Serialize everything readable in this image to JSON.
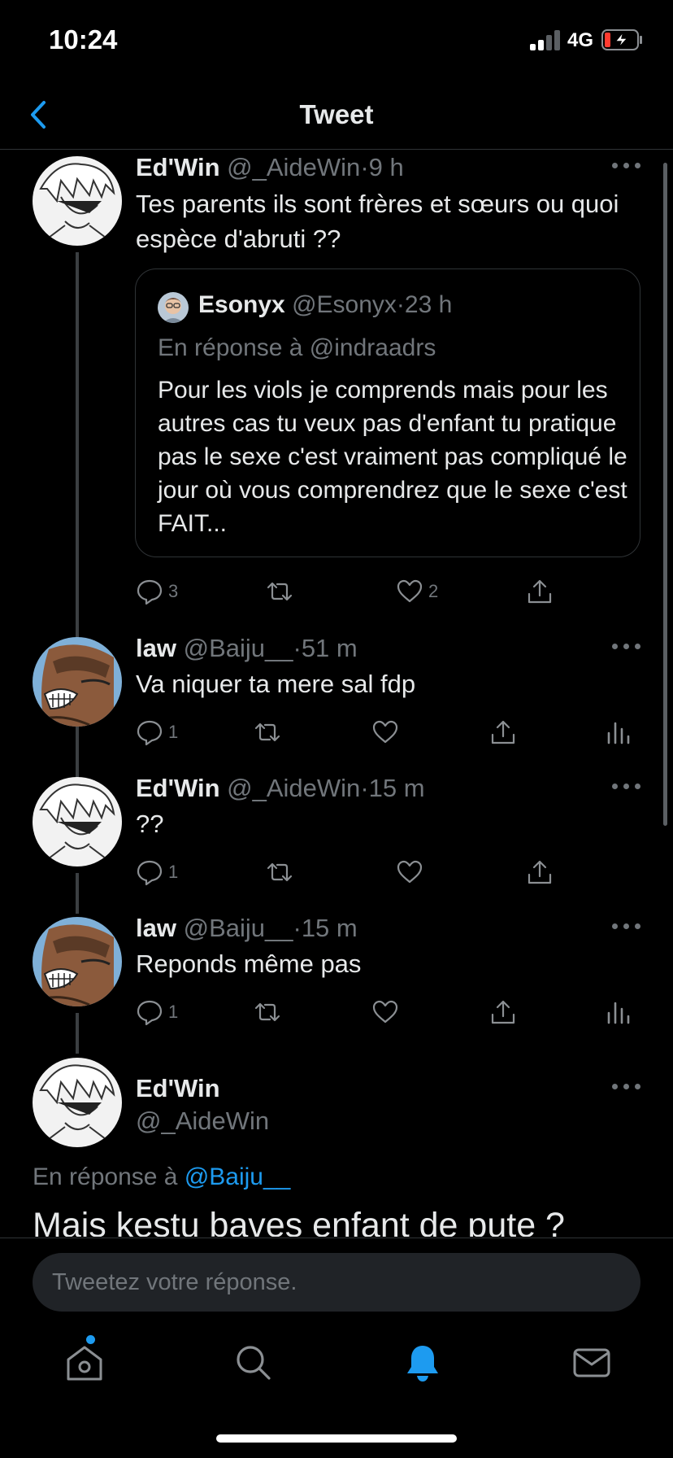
{
  "status_bar": {
    "time": "10:24",
    "network": "4G"
  },
  "header": {
    "title": "Tweet"
  },
  "tweets": [
    {
      "name": "Ed'Win",
      "handle": "@_AideWin",
      "dot": "·",
      "time": "9 h",
      "text": "Tes parents ils sont frères et sœurs ou quoi espèce d'abruti ??",
      "quote": {
        "name": "Esonyx",
        "handle": "@Esonyx",
        "dot": "·",
        "time": "23 h",
        "reply_to": "En réponse à @indraadrs",
        "text": "Pour les viols je comprends mais pour les autres cas tu veux pas d'enfant tu pratique pas le sexe c'est vraiment pas compliqué le jour où vous comprendrez que le sexe c'est FAIT..."
      },
      "replies": "3",
      "likes": "2"
    },
    {
      "name": "law",
      "handle": "@Baiju__",
      "dot": "·",
      "time": "51 m",
      "text": "Va niquer ta mere sal fdp",
      "replies": "1"
    },
    {
      "name": "Ed'Win",
      "handle": "@_AideWin",
      "dot": "·",
      "time": "15 m",
      "text": "??",
      "replies": "1"
    },
    {
      "name": "law",
      "handle": "@Baiju__",
      "dot": "·",
      "time": "15 m",
      "text": "Reponds même pas",
      "replies": "1"
    }
  ],
  "focused": {
    "name": "Ed'Win",
    "handle": "@_AideWin",
    "reply_prefix": "En réponse à",
    "reply_mention": "@Baiju__",
    "text": "Mais kestu baves enfant de pute ?"
  },
  "reply_bar": {
    "placeholder": "Tweetez votre réponse."
  },
  "colors": {
    "accent": "#1d9bf0",
    "background": "#000000",
    "muted": "#71767b"
  },
  "tab_bar": [
    "home-icon",
    "search-icon",
    "notifications-icon",
    "messages-icon"
  ]
}
